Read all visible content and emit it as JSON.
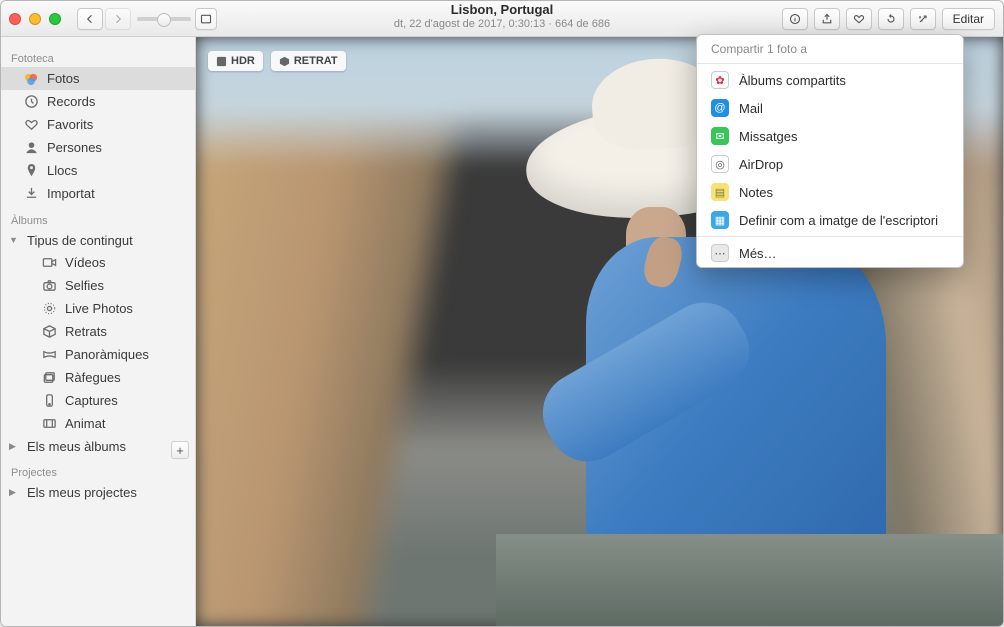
{
  "title": {
    "location": "Lisbon, Portugal",
    "meta": "dt, 22 d'agost de 2017, 0:30:13  ·  664 de 686"
  },
  "toolbar": {
    "edit_label": "Editar"
  },
  "badges": {
    "hdr": "HDR",
    "portrait": "RETRAT"
  },
  "sidebar": {
    "section_library": "Fototeca",
    "library": [
      {
        "label": "Fotos",
        "icon": "photos"
      },
      {
        "label": "Records",
        "icon": "clock"
      },
      {
        "label": "Favorits",
        "icon": "heart"
      },
      {
        "label": "Persones",
        "icon": "person"
      },
      {
        "label": "Llocs",
        "icon": "pin"
      },
      {
        "label": "Importat",
        "icon": "importdown"
      }
    ],
    "section_albums": "Àlbums",
    "content_type": {
      "label": "Tipus de contingut"
    },
    "content_items": [
      {
        "label": "Vídeos",
        "icon": "video"
      },
      {
        "label": "Selfies",
        "icon": "camera"
      },
      {
        "label": "Live Photos",
        "icon": "live"
      },
      {
        "label": "Retrats",
        "icon": "cube"
      },
      {
        "label": "Panoràmiques",
        "icon": "pano"
      },
      {
        "label": "Ràfegues",
        "icon": "stack"
      },
      {
        "label": "Captures",
        "icon": "device"
      },
      {
        "label": "Animat",
        "icon": "animate"
      }
    ],
    "my_albums": {
      "label": "Els meus àlbums"
    },
    "section_projects": "Projectes",
    "my_projects": {
      "label": "Els meus projectes"
    }
  },
  "share_menu": {
    "header": "Compartir 1 foto a",
    "items": [
      {
        "label": "Àlbums compartits",
        "color": "#ffffff",
        "glyph": "✿",
        "fg": "#e23"
      },
      {
        "label": "Mail",
        "color": "#1f8fe6",
        "glyph": "@"
      },
      {
        "label": "Missatges",
        "color": "#39c559",
        "glyph": "✉"
      },
      {
        "label": "AirDrop",
        "color": "#ffffff",
        "glyph": "◎",
        "fg": "#555"
      },
      {
        "label": "Notes",
        "color": "#f7e27a",
        "glyph": "▤",
        "fg": "#8a7a2a"
      },
      {
        "label": "Definir com a imatge de l'escriptori",
        "color": "#3aa9e8",
        "glyph": "▦"
      }
    ],
    "more": "Més…"
  }
}
